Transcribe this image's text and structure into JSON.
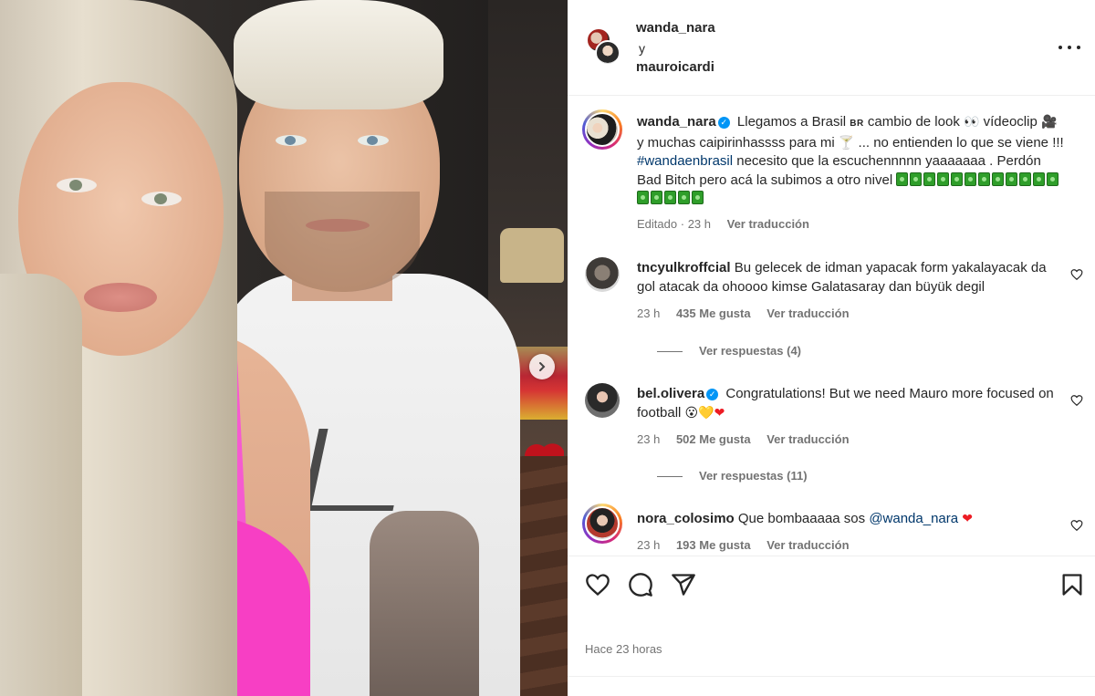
{
  "post": {
    "collab_user_1": "wanda_nara",
    "collab_and": "y",
    "collab_user_2": "mauroicardi",
    "caption": {
      "username": "wanda_nara",
      "text_1": "Llegamos a Brasil",
      "flag": "BR",
      "text_2": "cambio de look",
      "text_3": "vídeoclip",
      "text_4": "y muchas caipirinhassss para mi",
      "text_5": "... no entienden lo que se viene !!!",
      "hashtag": "#wandaenbrasil",
      "text_6": "necesito que la escuchennnnn yaaaaaaa . Perdón Bad Bitch pero acá la subimos a otro nivel",
      "eyes_emoji": "👀",
      "clapper_emoji": "🎥",
      "drink_emoji": "🍸",
      "edited": "Editado",
      "dot": "·",
      "time": "23 h",
      "translate": "Ver traducción"
    },
    "footer_time": "Hace 23 horas"
  },
  "comments": [
    {
      "username": "tncyulkroffcial",
      "text": "Bu gelecek de idman yapacak form yakalayacak da gol atacak da ohoooo kimse Galatasaray dan büyük degil",
      "time": "23 h",
      "likes": "435 Me gusta",
      "translate": "Ver traducción",
      "replies": "Ver respuestas (4)"
    },
    {
      "username": "bel.olivera",
      "text": "Congratulations! But we need Mauro more focused on football",
      "emoji_1": "😮",
      "emoji_2": "💛",
      "emoji_3": "❤",
      "time": "23 h",
      "likes": "502 Me gusta",
      "translate": "Ver traducción",
      "replies": "Ver respuestas (11)"
    },
    {
      "username": "nora_colosimo",
      "text": "Que bombaaaaa sos",
      "mention": "@wanda_nara",
      "emoji_1": "❤",
      "time": "23 h",
      "likes": "193 Me gusta",
      "translate": "Ver traducción"
    }
  ],
  "icons": {
    "more": "more-options-icon",
    "like": "heart-icon",
    "comment": "comment-icon",
    "share": "paper-plane-icon",
    "save": "bookmark-icon",
    "next": "chevron-right-icon",
    "verified": "verified-badge-icon",
    "verified_glyph": "✓"
  },
  "colors": {
    "verified": "#0095f6",
    "link": "#00376b",
    "muted": "#737373",
    "text": "#262626"
  }
}
